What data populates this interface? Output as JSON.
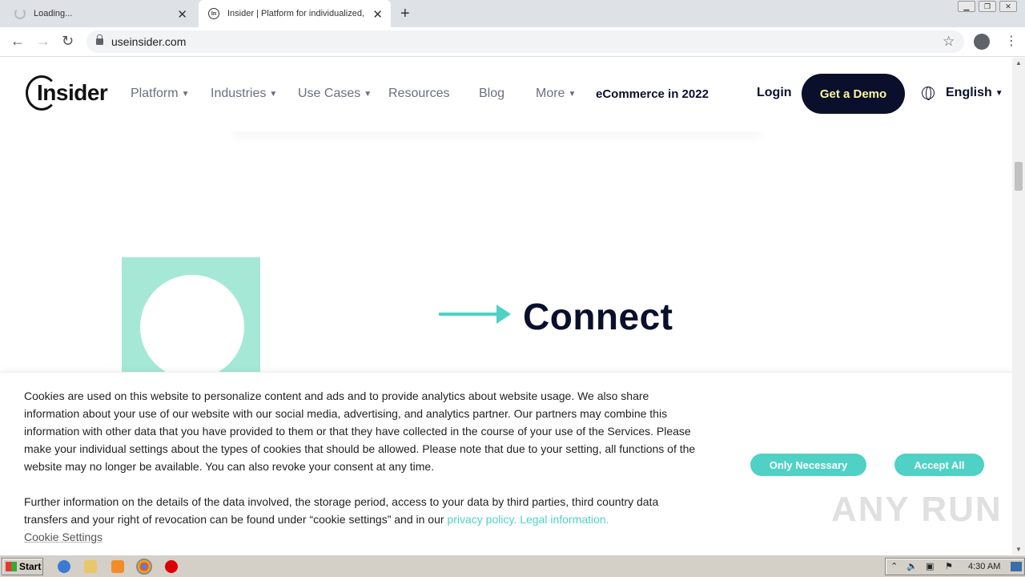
{
  "browser": {
    "tabs": [
      {
        "label": "Loading..."
      },
      {
        "label": "Insider | Platform for individualized, c"
      }
    ],
    "url": "useinsider.com"
  },
  "site": {
    "logo_text": "Insider",
    "nav": [
      {
        "label": "Platform"
      },
      {
        "label": "Industries"
      },
      {
        "label": "Use Cases"
      },
      {
        "label": "Resources"
      },
      {
        "label": "Blog"
      },
      {
        "label": "More"
      }
    ],
    "ecommerce_link": "eCommerce in 2022",
    "login": "Login",
    "demo_button": "Get a Demo",
    "language": "English",
    "colors": {
      "navy": "#0a0f2c",
      "teal": "#4fd1c5",
      "mint": "#a6e8d6",
      "demo_text": "#fff5a0"
    }
  },
  "hero": {
    "heading": "Connect"
  },
  "cookie_banner": {
    "paragraph1": "Cookies are used on this website to personalize content and ads and to provide analytics about website usage. We also share information about your use of our website with our social media, advertising, and analytics partner. Our partners may combine this information with other data that you have provided to them or that they have collected in the course of your use of the Services. Please make your individual settings about the types of cookies that should be allowed. Please note that due to your setting, all functions of the website may no longer be available. You can also revoke your consent at any time.",
    "paragraph2_prefix": "Further information on the details of the data involved, the storage period, access to your data by third parties, third country data transfers and your right of revocation can be found under “cookie settings” and in our ",
    "privacy_link": "privacy policy.",
    "legal_link": "Legal information.",
    "settings_link": "Cookie Settings",
    "only_necessary": "Only Necessary",
    "accept_all": "Accept All"
  },
  "watermark": "ANY RUN",
  "taskbar": {
    "start": "Start",
    "clock": "4:30 AM"
  }
}
